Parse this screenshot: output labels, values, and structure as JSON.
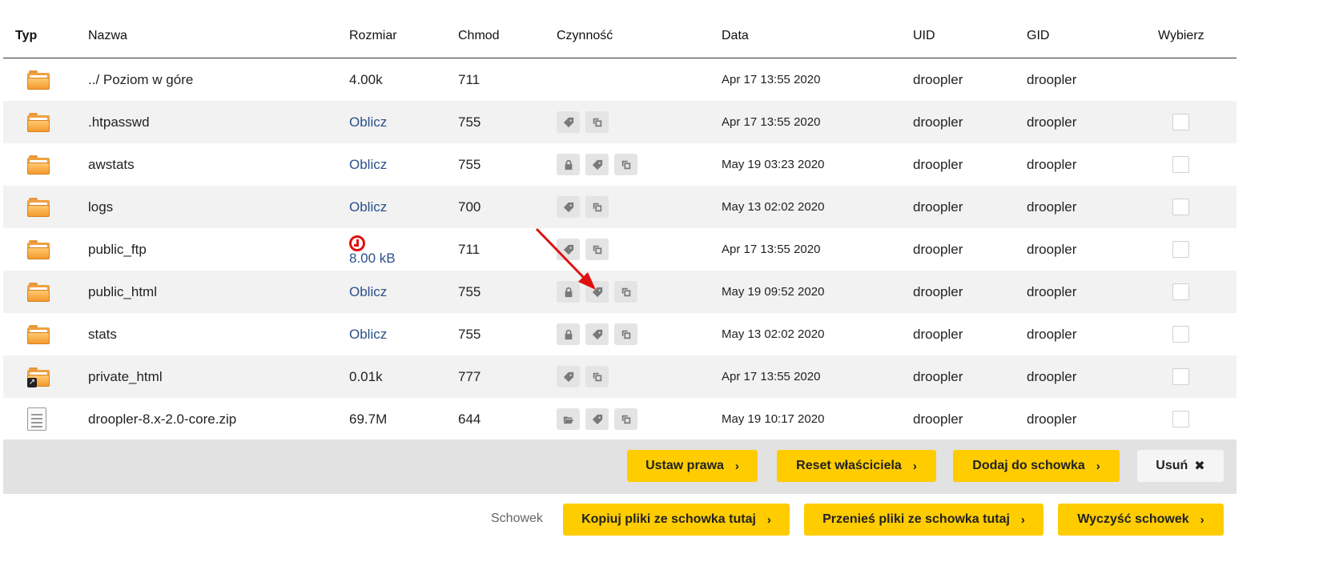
{
  "columns": {
    "type": "Typ",
    "name": "Nazwa",
    "size": "Rozmiar",
    "chmod": "Chmod",
    "action": "Czynność",
    "date": "Data",
    "uid": "UID",
    "gid": "GID",
    "select": "Wybierz"
  },
  "rows": [
    {
      "name": "../ Poziom w góre",
      "size": "4.00k",
      "chmod": "711",
      "date": "Apr 17 13:55 2020",
      "uid": "droopler",
      "gid": "droopler"
    },
    {
      "name": ".htpasswd",
      "size": "Oblicz",
      "chmod": "755",
      "date": "Apr 17 13:55 2020",
      "uid": "droopler",
      "gid": "droopler"
    },
    {
      "name": "awstats",
      "size": "Oblicz",
      "chmod": "755",
      "date": "May 19 03:23 2020",
      "uid": "droopler",
      "gid": "droopler"
    },
    {
      "name": "logs",
      "size": "Oblicz",
      "chmod": "700",
      "date": "May 13 02:02 2020",
      "uid": "droopler",
      "gid": "droopler"
    },
    {
      "name": "public_ftp",
      "size": "8.00 kB",
      "chmod": "711",
      "date": "Apr 17 13:55 2020",
      "uid": "droopler",
      "gid": "droopler"
    },
    {
      "name": "public_html",
      "size": "Oblicz",
      "chmod": "755",
      "date": "May 19 09:52 2020",
      "uid": "droopler",
      "gid": "droopler"
    },
    {
      "name": "stats",
      "size": "Oblicz",
      "chmod": "755",
      "date": "May 13 02:02 2020",
      "uid": "droopler",
      "gid": "droopler"
    },
    {
      "name": "private_html",
      "size": "0.01k",
      "chmod": "777",
      "date": "Apr 17 13:55 2020",
      "uid": "droopler",
      "gid": "droopler"
    },
    {
      "name": "droopler-8.x-2.0-core.zip",
      "size": "69.7M",
      "chmod": "644",
      "date": "May 19 10:17 2020",
      "uid": "droopler",
      "gid": "droopler"
    }
  ],
  "actions": {
    "set_permissions": "Ustaw prawa",
    "reset_owner": "Reset właściciela",
    "add_to_clipboard": "Dodaj do schowka",
    "delete": "Usuń"
  },
  "clipboard": {
    "label": "Schowek",
    "copy_here": "Kopiuj pliki ze schowka tutaj",
    "move_here": "Przenieś pliki ze schowka tutaj",
    "clear": "Wyczyść schowek"
  },
  "colors": {
    "accent_button": "#ffcc00",
    "link": "#2a4f8a",
    "folder": "#f0a040",
    "alert": "#e01010"
  }
}
